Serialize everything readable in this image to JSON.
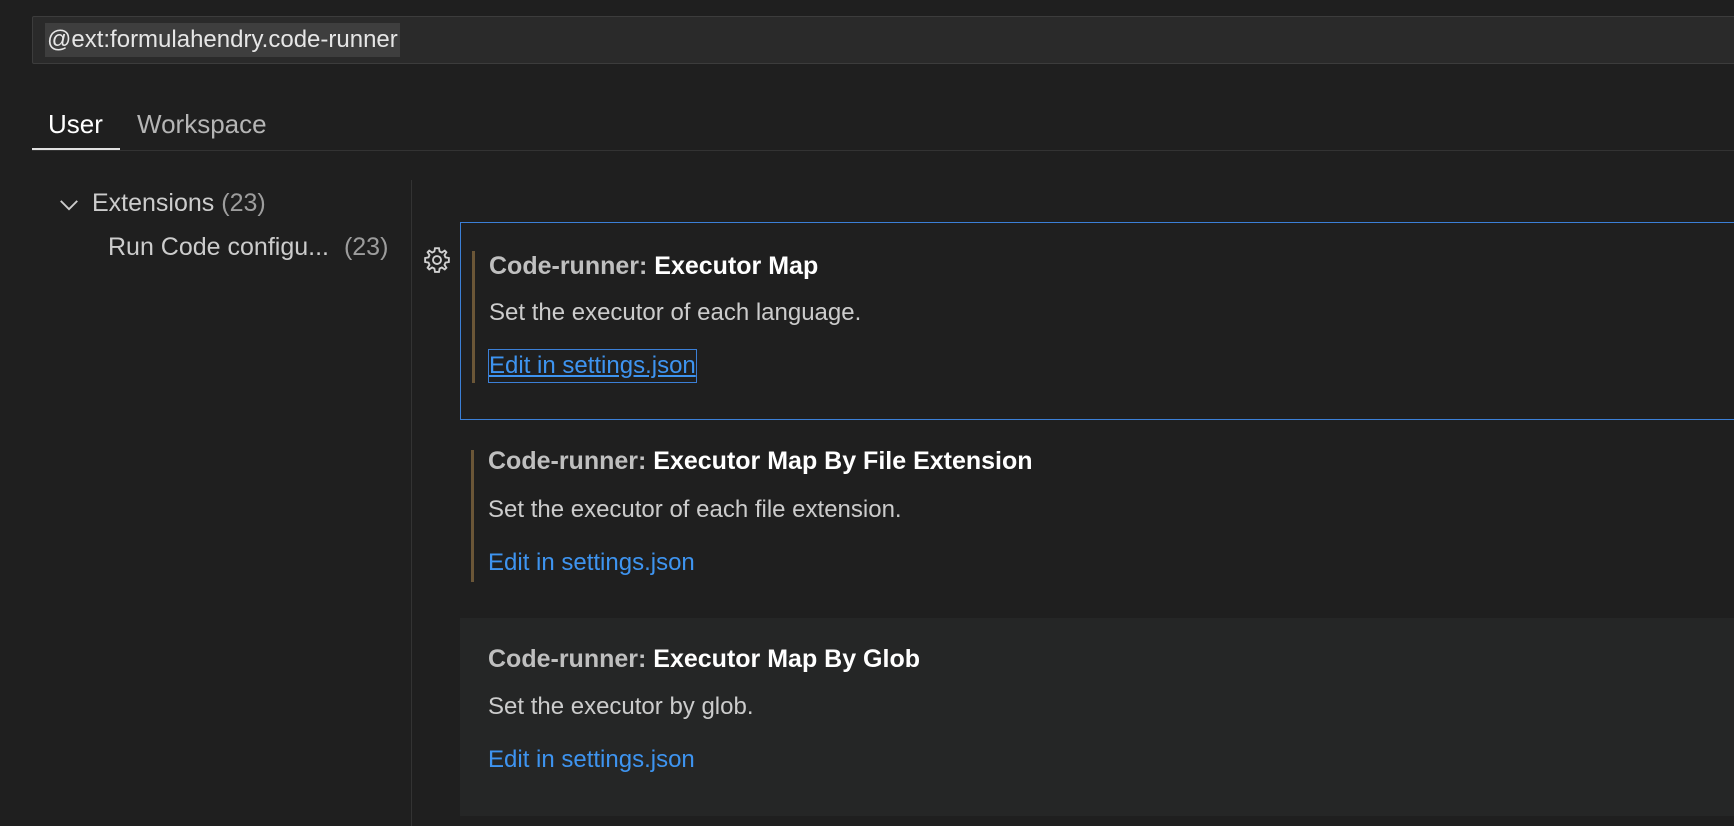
{
  "search": {
    "value": "@ext:formulahendry.code-runner"
  },
  "tabs": [
    {
      "label": "User",
      "active": true
    },
    {
      "label": "Workspace",
      "active": false
    }
  ],
  "toc": {
    "group": {
      "label": "Extensions",
      "count": "(23)",
      "icon": "chevron-down-icon"
    },
    "item": {
      "label": "Run Code configu...",
      "count": "(23)"
    }
  },
  "settings": [
    {
      "category": "Code-runner:",
      "name": "Executor Map",
      "description": "Set the executor of each language.",
      "link": "Edit in settings.json",
      "modified": true,
      "focused": true
    },
    {
      "category": "Code-runner:",
      "name": "Executor Map By File Extension",
      "description": "Set the executor of each file extension.",
      "link": "Edit in settings.json",
      "modified": true,
      "focused": false
    },
    {
      "category": "Code-runner:",
      "name": "Executor Map By Glob",
      "description": "Set the executor by glob.",
      "link": "Edit in settings.json",
      "modified": false,
      "focused": false
    }
  ],
  "colors": {
    "background": "#1f1f1f",
    "focus_border": "#3b7fd6",
    "link": "#3e94f0",
    "modified_indicator": "#6b5637"
  }
}
